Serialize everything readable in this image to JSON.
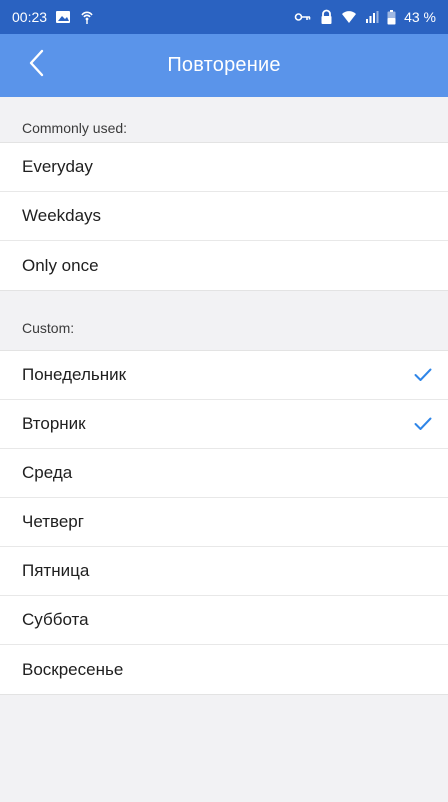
{
  "status_bar": {
    "time": "00:23",
    "battery": "43 %",
    "icons": [
      "image-icon",
      "wifi-tether-icon",
      "key-icon",
      "lock-icon",
      "wifi-icon",
      "signal-icon",
      "battery-icon"
    ]
  },
  "app_bar": {
    "title": "Повторение",
    "back_icon": "chevron-left-icon"
  },
  "sections": [
    {
      "header": "Commonly used:",
      "items": [
        {
          "label": "Everyday",
          "checked": false
        },
        {
          "label": "Weekdays",
          "checked": false
        },
        {
          "label": "Only once",
          "checked": false
        }
      ]
    },
    {
      "header": "Custom:",
      "items": [
        {
          "label": "Понедельник",
          "checked": true
        },
        {
          "label": "Вторник",
          "checked": true
        },
        {
          "label": "Среда",
          "checked": false
        },
        {
          "label": "Четверг",
          "checked": false
        },
        {
          "label": "Пятница",
          "checked": false
        },
        {
          "label": "Суббота",
          "checked": false
        },
        {
          "label": "Воскресенье",
          "checked": false
        }
      ]
    }
  ],
  "colors": {
    "status_bar": "#2a62c1",
    "app_bar": "#5a94ea",
    "check": "#2f86e8"
  }
}
